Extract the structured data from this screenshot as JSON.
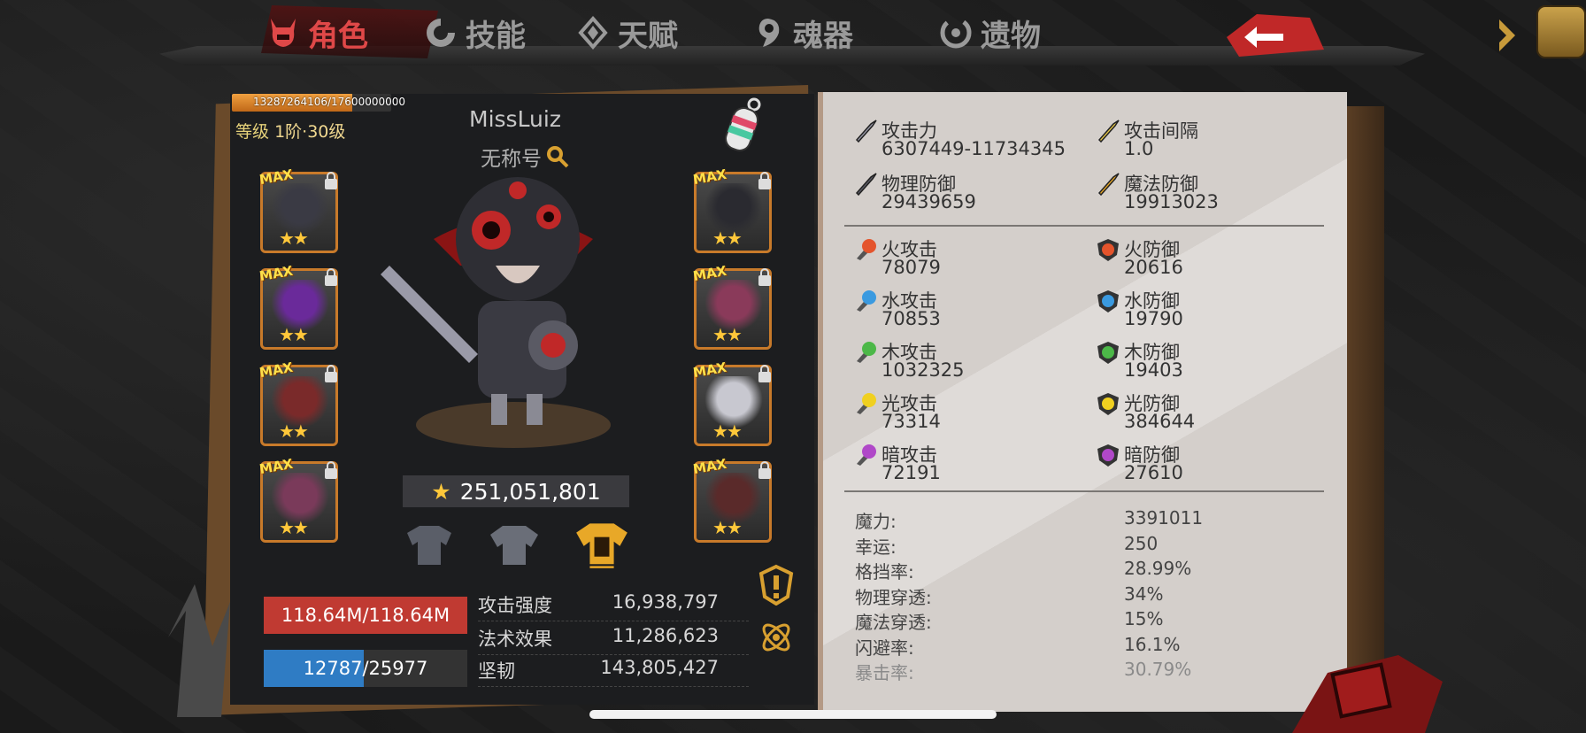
{
  "tabs": [
    {
      "label": "角色",
      "icon": "devil-icon",
      "active": true
    },
    {
      "label": "技能",
      "icon": "skill-swirl-icon",
      "active": false
    },
    {
      "label": "天赋",
      "icon": "talent-diamond-icon",
      "active": false
    },
    {
      "label": "魂器",
      "icon": "soul-gem-icon",
      "active": false
    },
    {
      "label": "遗物",
      "icon": "relic-swirl-icon",
      "active": false
    }
  ],
  "accent_red": "#e04848",
  "player": {
    "exp_text": "13287264106/17600000000",
    "exp_fraction": 0.755,
    "level": "等级",
    "rank": "1阶·30级",
    "name": "MissLuiz",
    "title": "无称号"
  },
  "equipment": {
    "max_label": "MAX",
    "stars": "★★",
    "left": [
      "skull-helmet",
      "purple-cape",
      "red-eye-armor",
      "claw-weapon"
    ],
    "right": [
      "spiked-gauntlet",
      "tentacle-ring",
      "silver-boots",
      "spiked-claw"
    ]
  },
  "power": {
    "star": "★",
    "value": "251,051,801"
  },
  "gear_tabs": [
    "armor-tab-1",
    "armor-tab-2",
    "armor-tab-3"
  ],
  "bars": {
    "hp": {
      "text": "118.64M/118.64M",
      "fraction": 1.0,
      "color": "#c03a32"
    },
    "mp": {
      "text": "12787/25977",
      "fraction": 0.492,
      "color": "#2f7cc4"
    }
  },
  "base_stats": [
    {
      "label": "攻击强度",
      "value": "16,938,797"
    },
    {
      "label": "法术效果",
      "value": "11,286,623"
    },
    {
      "label": "坚韧",
      "value": "143,805,427"
    }
  ],
  "stats_top": [
    {
      "label": "攻击力",
      "value": "6307449-11734345",
      "icon": "sword-icon"
    },
    {
      "label": "攻击间隔",
      "value": "1.0",
      "icon": "sword-speed-icon"
    },
    {
      "label": "物理防御",
      "value": "29439659",
      "icon": "shield-icon"
    },
    {
      "label": "魔法防御",
      "value": "19913023",
      "icon": "magic-hammer-icon"
    }
  ],
  "stats_elem": [
    {
      "label": "火攻击",
      "value": "78079",
      "icon": "fire-attack-icon",
      "color": "#e4542c"
    },
    {
      "label": "火防御",
      "value": "20616",
      "icon": "fire-defense-icon",
      "color": "#e4542c"
    },
    {
      "label": "水攻击",
      "value": "70853",
      "icon": "water-attack-icon",
      "color": "#3a9ae0"
    },
    {
      "label": "水防御",
      "value": "19790",
      "icon": "water-defense-icon",
      "color": "#3a9ae0"
    },
    {
      "label": "木攻击",
      "value": "1032325",
      "icon": "wood-attack-icon",
      "color": "#4cb848"
    },
    {
      "label": "木防御",
      "value": "19403",
      "icon": "wood-defense-icon",
      "color": "#4cb848"
    },
    {
      "label": "光攻击",
      "value": "73314",
      "icon": "light-attack-icon",
      "color": "#f0d020"
    },
    {
      "label": "光防御",
      "value": "384644",
      "icon": "light-defense-icon",
      "color": "#f0d020"
    },
    {
      "label": "暗攻击",
      "value": "72191",
      "icon": "dark-attack-icon",
      "color": "#b048c8"
    },
    {
      "label": "暗防御",
      "value": "27610",
      "icon": "dark-defense-icon",
      "color": "#b048c8"
    }
  ],
  "stats_misc": [
    {
      "label": "魔力:",
      "value": "3391011"
    },
    {
      "label": "幸运:",
      "value": "250"
    },
    {
      "label": "格挡率:",
      "value": "28.99%"
    },
    {
      "label": "物理穿透:",
      "value": "34%"
    },
    {
      "label": "魔法穿透:",
      "value": "15%"
    },
    {
      "label": "闪避率:",
      "value": "16.1%"
    },
    {
      "label": "暴击率:",
      "value": "30.79%"
    }
  ]
}
